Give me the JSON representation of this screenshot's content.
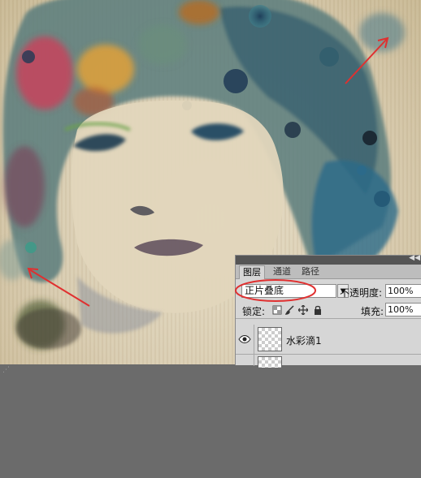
{
  "layers_panel": {
    "tabs": [
      "图层",
      "通道",
      "路径"
    ],
    "blend_mode": "正片叠底",
    "opacity_label": "不透明度:",
    "opacity_value": "100%",
    "lock_label": "锁定:",
    "fill_label": "填充:",
    "fill_value": "100%",
    "layers": [
      {
        "name": "水彩滴1",
        "visible": true
      },
      {
        "name": "",
        "visible": false
      }
    ]
  },
  "colors": {
    "annotation": "#e03030",
    "panel_bg": "#d6d6d6",
    "workspace": "#6b6b6b"
  },
  "icons": [
    "eye-icon",
    "lock-transparency-icon",
    "brush-icon",
    "move-icon",
    "lock-icon",
    "dropdown-arrow-icon",
    "panel-collapse-icon"
  ]
}
